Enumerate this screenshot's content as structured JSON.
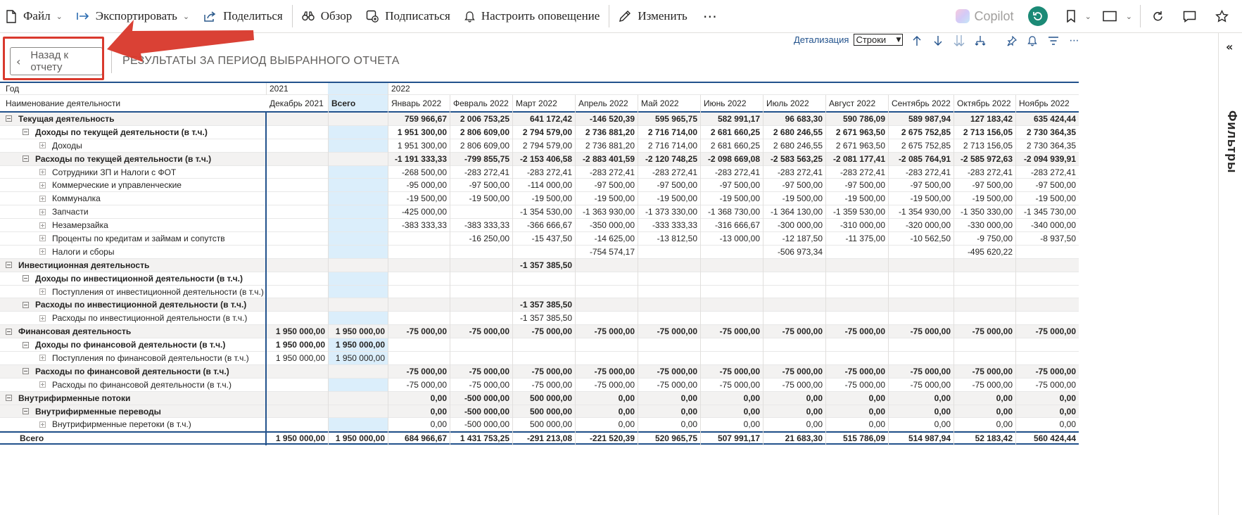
{
  "toolbar": {
    "file": "Файл",
    "export": "Экспортировать",
    "share": "Поделиться",
    "review": "Обзор",
    "subscribe": "Подписаться",
    "alert": "Настроить оповещение",
    "edit": "Изменить",
    "more": "⋯",
    "copilot": "Copilot"
  },
  "filters_label": "Фильтры",
  "back_button": "Назад к отчету",
  "report_title": "РЕЗУЛЬТАТЫ ЗА ПЕРИОД ВЫБРАННОГО ОТЧЕТА",
  "drill": {
    "label": "Детализация",
    "value": "Строки"
  },
  "matrix": {
    "year_label": "Год",
    "name_label": "Наименование деятельности",
    "year_2021": "2021",
    "year_2022": "2022",
    "columns": [
      "Декабрь 2021",
      "Всего",
      "Январь 2022",
      "Февраль 2022",
      "Март 2022",
      "Апрель 2022",
      "Май 2022",
      "Июнь 2022",
      "Июль 2022",
      "Август 2022",
      "Сентябрь 2022",
      "Октябрь 2022",
      "Ноябрь 2022"
    ],
    "rows": [
      {
        "label": "Текущая деятельность",
        "level": 0,
        "bold": true,
        "expander": "minus",
        "shaded": true,
        "values": [
          "",
          "",
          "759 966,67",
          "2 006 753,25",
          "641 172,42",
          "-146 520,39",
          "595 965,75",
          "582 991,17",
          "96 683,30",
          "590 786,09",
          "589 987,94",
          "127 183,42",
          "635 424,44"
        ]
      },
      {
        "label": "Доходы по текущей деятельности (в т.ч.)",
        "level": 1,
        "bold": true,
        "expander": "minus",
        "shaded": false,
        "values": [
          "",
          "",
          "1 951 300,00",
          "2 806 609,00",
          "2 794 579,00",
          "2 736 881,20",
          "2 716 714,00",
          "2 681 660,25",
          "2 680 246,55",
          "2 671 963,50",
          "2 675 752,85",
          "2 713 156,05",
          "2 730 364,35"
        ]
      },
      {
        "label": "Доходы",
        "level": 2,
        "bold": false,
        "expander": "plus",
        "shaded": false,
        "values": [
          "",
          "",
          "1 951 300,00",
          "2 806 609,00",
          "2 794 579,00",
          "2 736 881,20",
          "2 716 714,00",
          "2 681 660,25",
          "2 680 246,55",
          "2 671 963,50",
          "2 675 752,85",
          "2 713 156,05",
          "2 730 364,35"
        ]
      },
      {
        "label": "Расходы по текущей деятельности (в т.ч.)",
        "level": 1,
        "bold": true,
        "expander": "minus",
        "shaded": true,
        "values": [
          "",
          "",
          "-1 191 333,33",
          "-799 855,75",
          "-2 153 406,58",
          "-2 883 401,59",
          "-2 120 748,25",
          "-2 098 669,08",
          "-2 583 563,25",
          "-2 081 177,41",
          "-2 085 764,91",
          "-2 585 972,63",
          "-2 094 939,91"
        ]
      },
      {
        "label": "Сотрудники ЗП и Налоги с ФОТ",
        "level": 2,
        "bold": false,
        "expander": "plus",
        "shaded": false,
        "values": [
          "",
          "",
          "-268 500,00",
          "-283 272,41",
          "-283 272,41",
          "-283 272,41",
          "-283 272,41",
          "-283 272,41",
          "-283 272,41",
          "-283 272,41",
          "-283 272,41",
          "-283 272,41",
          "-283 272,41"
        ]
      },
      {
        "label": "Коммерческие и управленческие",
        "level": 2,
        "bold": false,
        "expander": "plus",
        "shaded": false,
        "values": [
          "",
          "",
          "-95 000,00",
          "-97 500,00",
          "-114 000,00",
          "-97 500,00",
          "-97 500,00",
          "-97 500,00",
          "-97 500,00",
          "-97 500,00",
          "-97 500,00",
          "-97 500,00",
          "-97 500,00"
        ]
      },
      {
        "label": "Коммуналка",
        "level": 2,
        "bold": false,
        "expander": "plus",
        "shaded": false,
        "values": [
          "",
          "",
          "-19 500,00",
          "-19 500,00",
          "-19 500,00",
          "-19 500,00",
          "-19 500,00",
          "-19 500,00",
          "-19 500,00",
          "-19 500,00",
          "-19 500,00",
          "-19 500,00",
          "-19 500,00"
        ]
      },
      {
        "label": "Запчасти",
        "level": 2,
        "bold": false,
        "expander": "plus",
        "shaded": false,
        "values": [
          "",
          "",
          "-425 000,00",
          "",
          "-1 354 530,00",
          "-1 363 930,00",
          "-1 373 330,00",
          "-1 368 730,00",
          "-1 364 130,00",
          "-1 359 530,00",
          "-1 354 930,00",
          "-1 350 330,00",
          "-1 345 730,00"
        ]
      },
      {
        "label": "Незамерзайка",
        "level": 2,
        "bold": false,
        "expander": "plus",
        "shaded": false,
        "values": [
          "",
          "",
          "-383 333,33",
          "-383 333,33",
          "-366 666,67",
          "-350 000,00",
          "-333 333,33",
          "-316 666,67",
          "-300 000,00",
          "-310 000,00",
          "-320 000,00",
          "-330 000,00",
          "-340 000,00"
        ]
      },
      {
        "label": "Проценты по кредитам и займам и сопутств",
        "level": 2,
        "bold": false,
        "expander": "plus",
        "shaded": false,
        "values": [
          "",
          "",
          "",
          "-16 250,00",
          "-15 437,50",
          "-14 625,00",
          "-13 812,50",
          "-13 000,00",
          "-12 187,50",
          "-11 375,00",
          "-10 562,50",
          "-9 750,00",
          "-8 937,50"
        ]
      },
      {
        "label": "Налоги и сборы",
        "level": 2,
        "bold": false,
        "expander": "plus",
        "shaded": false,
        "values": [
          "",
          "",
          "",
          "",
          "",
          "-754 574,17",
          "",
          "",
          "-506 973,34",
          "",
          "",
          "-495 620,22",
          ""
        ]
      },
      {
        "label": "Инвестиционная деятельность",
        "level": 0,
        "bold": true,
        "expander": "minus",
        "shaded": true,
        "values": [
          "",
          "",
          "",
          "",
          "-1 357 385,50",
          "",
          "",
          "",
          "",
          "",
          "",
          "",
          ""
        ]
      },
      {
        "label": "Доходы по инвестиционной деятельности (в т.ч.)",
        "level": 1,
        "bold": true,
        "expander": "minus",
        "shaded": false,
        "values": [
          "",
          "",
          "",
          "",
          "",
          "",
          "",
          "",
          "",
          "",
          "",
          "",
          ""
        ]
      },
      {
        "label": "Поступления от инвестиционной деятельности (в т.ч.)",
        "level": 2,
        "bold": false,
        "expander": "plus",
        "shaded": false,
        "values": [
          "",
          "",
          "",
          "",
          "",
          "",
          "",
          "",
          "",
          "",
          "",
          "",
          ""
        ]
      },
      {
        "label": "Расходы по инвестиционной деятельности (в т.ч.)",
        "level": 1,
        "bold": true,
        "expander": "minus",
        "shaded": true,
        "values": [
          "",
          "",
          "",
          "",
          "-1 357 385,50",
          "",
          "",
          "",
          "",
          "",
          "",
          "",
          ""
        ]
      },
      {
        "label": "Расходы по инвестиционной деятельности (в т.ч.)",
        "level": 2,
        "bold": false,
        "expander": "plus",
        "shaded": false,
        "values": [
          "",
          "",
          "",
          "",
          "-1 357 385,50",
          "",
          "",
          "",
          "",
          "",
          "",
          "",
          ""
        ]
      },
      {
        "label": "Финансовая деятельность",
        "level": 0,
        "bold": true,
        "expander": "minus",
        "shaded": true,
        "values": [
          "1 950 000,00",
          "1 950 000,00",
          "-75 000,00",
          "-75 000,00",
          "-75 000,00",
          "-75 000,00",
          "-75 000,00",
          "-75 000,00",
          "-75 000,00",
          "-75 000,00",
          "-75 000,00",
          "-75 000,00",
          "-75 000,00"
        ]
      },
      {
        "label": "Доходы по финансовой деятельности (в т.ч.)",
        "level": 1,
        "bold": true,
        "expander": "minus",
        "shaded": false,
        "values": [
          "1 950 000,00",
          "1 950 000,00",
          "",
          "",
          "",
          "",
          "",
          "",
          "",
          "",
          "",
          "",
          ""
        ]
      },
      {
        "label": "Поступления по финансовой деятельности (в т.ч.)",
        "level": 2,
        "bold": false,
        "expander": "plus",
        "shaded": false,
        "values": [
          "1 950 000,00",
          "1 950 000,00",
          "",
          "",
          "",
          "",
          "",
          "",
          "",
          "",
          "",
          "",
          ""
        ]
      },
      {
        "label": "Расходы по финансовой деятельности (в т.ч.)",
        "level": 1,
        "bold": true,
        "expander": "minus",
        "shaded": true,
        "values": [
          "",
          "",
          "-75 000,00",
          "-75 000,00",
          "-75 000,00",
          "-75 000,00",
          "-75 000,00",
          "-75 000,00",
          "-75 000,00",
          "-75 000,00",
          "-75 000,00",
          "-75 000,00",
          "-75 000,00"
        ]
      },
      {
        "label": "Расходы по финансовой деятельности (в т.ч.)",
        "level": 2,
        "bold": false,
        "expander": "plus",
        "shaded": false,
        "values": [
          "",
          "",
          "-75 000,00",
          "-75 000,00",
          "-75 000,00",
          "-75 000,00",
          "-75 000,00",
          "-75 000,00",
          "-75 000,00",
          "-75 000,00",
          "-75 000,00",
          "-75 000,00",
          "-75 000,00"
        ]
      },
      {
        "label": "Внутрифирменные потоки",
        "level": 0,
        "bold": true,
        "expander": "minus",
        "shaded": true,
        "values": [
          "",
          "",
          "0,00",
          "-500 000,00",
          "500 000,00",
          "0,00",
          "0,00",
          "0,00",
          "0,00",
          "0,00",
          "0,00",
          "0,00",
          "0,00"
        ]
      },
      {
        "label": "Внутрифирменные переводы",
        "level": 1,
        "bold": true,
        "expander": "minus",
        "shaded": true,
        "values": [
          "",
          "",
          "0,00",
          "-500 000,00",
          "500 000,00",
          "0,00",
          "0,00",
          "0,00",
          "0,00",
          "0,00",
          "0,00",
          "0,00",
          "0,00"
        ]
      },
      {
        "label": "Внутрифирменные перетоки (в т.ч.)",
        "level": 2,
        "bold": false,
        "expander": "plus",
        "shaded": false,
        "values": [
          "",
          "",
          "0,00",
          "-500 000,00",
          "500 000,00",
          "0,00",
          "0,00",
          "0,00",
          "0,00",
          "0,00",
          "0,00",
          "0,00",
          "0,00"
        ]
      },
      {
        "label": "Всего",
        "level": 0,
        "bold": true,
        "expander": "none",
        "shaded": false,
        "total": true,
        "values": [
          "1 950 000,00",
          "1 950 000,00",
          "684 966,67",
          "1 431 753,25",
          "-291 213,08",
          "-221 520,39",
          "520 965,75",
          "507 991,17",
          "21 683,30",
          "515 786,09",
          "514 987,94",
          "52 183,42",
          "560 424,44"
        ]
      }
    ]
  }
}
